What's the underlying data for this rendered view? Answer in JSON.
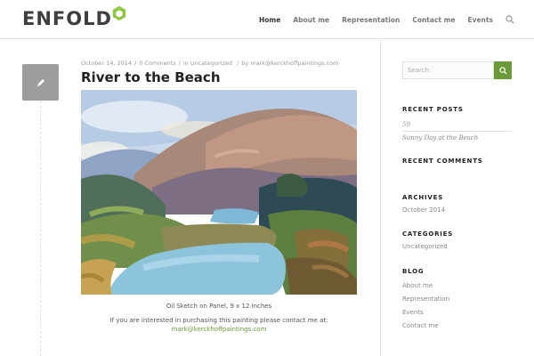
{
  "header": {
    "logo_text": "ENFOLD",
    "nav": [
      {
        "label": "Home",
        "active": true
      },
      {
        "label": "About me",
        "active": false
      },
      {
        "label": "Representation",
        "active": false
      },
      {
        "label": "Contact me",
        "active": false
      },
      {
        "label": "Events",
        "active": false
      }
    ],
    "search_icon": "search-icon"
  },
  "post": {
    "icon": "pencil-icon",
    "date": "October 14, 2014",
    "comments": "0 Comments",
    "category": "in Uncategorized",
    "author": "by mark@kerckhoffpaintings.com",
    "title": "River to the Beach",
    "caption": "Oil Sketch on Panel, 9 x 12 inches",
    "contact_text": "If you are interested in purchasing this painting please contact me at:",
    "contact_email": "mark@kerckhoffpaintings.com"
  },
  "sidebar": {
    "search_placeholder": "Search",
    "recent_posts_title": "RECENT POSTS",
    "recent_posts_number": "59",
    "recent_posts": [
      "Sunny Day at the Beach"
    ],
    "recent_comments_title": "RECENT COMMENTS",
    "archives_title": "ARCHIVES",
    "archives": [
      "October 2014"
    ],
    "categories_title": "CATEGORIES",
    "categories": [
      "Uncategorized"
    ],
    "blog_title": "BLOG",
    "blog_links": [
      "About me",
      "Representation",
      "Events",
      "Contact me"
    ]
  },
  "colors": {
    "accent": "#6b9a3a",
    "post_icon_bg": "#9d9d9d"
  }
}
